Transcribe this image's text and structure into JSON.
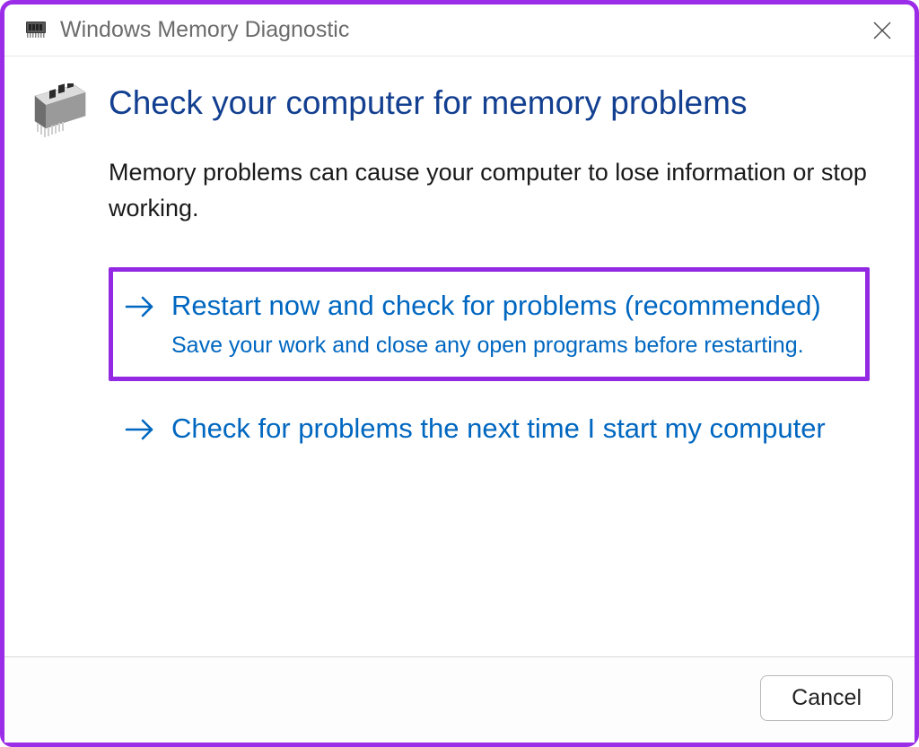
{
  "titlebar": {
    "title": "Windows Memory Diagnostic"
  },
  "main": {
    "heading": "Check your computer for memory problems",
    "description": "Memory problems can cause your computer to lose information or stop working."
  },
  "options": {
    "restart_now": {
      "title": "Restart now and check for problems (recommended)",
      "subtitle": "Save your work and close any open programs before restarting."
    },
    "next_time": {
      "title": "Check for problems the next time I start my computer"
    }
  },
  "footer": {
    "cancel_label": "Cancel"
  },
  "colors": {
    "accent": "#0067c0",
    "heading": "#123f90",
    "highlight_border": "#9329e2"
  }
}
